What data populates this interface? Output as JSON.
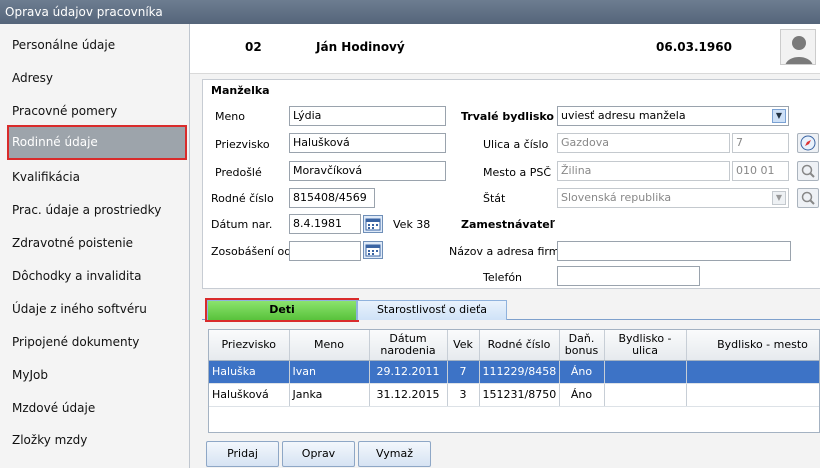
{
  "window": {
    "title": "Oprava údajov pracovníka"
  },
  "sidebar": {
    "items": [
      {
        "label": "Personálne údaje"
      },
      {
        "label": "Adresy"
      },
      {
        "label": "Pracovné pomery"
      },
      {
        "label": "Rodinné údaje"
      },
      {
        "label": "Kvalifikácia"
      },
      {
        "label": "Prac. údaje a prostriedky"
      },
      {
        "label": "Zdravotné poistenie"
      },
      {
        "label": "Dôchodky a invalidita"
      },
      {
        "label": "Údaje z iného softvéru"
      },
      {
        "label": "Pripojené dokumenty"
      },
      {
        "label": "MyJob"
      },
      {
        "label": "Mzdové údaje"
      },
      {
        "label": "Zložky mzdy"
      }
    ],
    "active": "Rodinné údaje"
  },
  "header": {
    "number": "02",
    "name": "Ján Hodinový",
    "date": "06.03.1960"
  },
  "spouse": {
    "section_title": "Manželka",
    "meno_label": "Meno",
    "meno": "Lýdia",
    "priezvisko_label": "Priezvisko",
    "priezvisko": "Halušková",
    "predosle_label": "Predošlé",
    "predosle": "Moravčíková",
    "rodne_cislo_label": "Rodné číslo",
    "rodne_cislo": "815408/4569",
    "datum_nar_label": "Dátum nar.",
    "datum_nar": "8.4.1981",
    "vek_label": "Vek 38",
    "zosobasenie_label": "Zosobášení od",
    "zosobasenie": "",
    "trvale_bydlisko_label": "Trvalé bydlisko",
    "trvale_bydlisko": "uviesť adresu manžela",
    "ulica_label": "Ulica a číslo",
    "ulica": "Gazdova",
    "cislo": "7",
    "mesto_label": "Mesto a PSČ",
    "mesto": "Žilina",
    "psc": "010 01",
    "stat_label": "Štát",
    "stat": "Slovenská republika",
    "zamestnavatel_label": "Zamestnávateľ",
    "firma_label": "Názov a adresa firmy",
    "firma": "",
    "telefon_label": "Telefón",
    "telefon": ""
  },
  "tabs": [
    {
      "label": "Deti"
    },
    {
      "label": "Starostlivosť o dieťa"
    }
  ],
  "children_table": {
    "headers": [
      "Priezvisko",
      "Meno",
      "Dátum narodenia",
      "Vek",
      "Rodné číslo",
      "Daň. bonus",
      "Bydlisko - ulica",
      "Bydlisko - mesto"
    ],
    "rows": [
      [
        "Haluška",
        "Ivan",
        "29.12.2011",
        "7",
        "111229/8458",
        "Áno",
        "",
        ""
      ],
      [
        "Halušková",
        "Janka",
        "31.12.2015",
        "3",
        "151231/8750",
        "Áno",
        "",
        ""
      ]
    ]
  },
  "buttons": {
    "add": "Pridaj",
    "edit": "Oprav",
    "delete": "Vymaž"
  },
  "colors": {
    "titlebar": "#5f6f83",
    "active_tab": "#6cd24c",
    "selected_row": "#3d73c6",
    "highlight": "#d92b2b"
  }
}
